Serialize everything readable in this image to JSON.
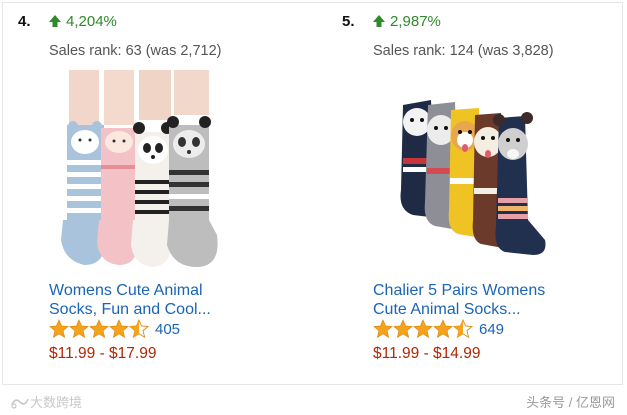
{
  "products": [
    {
      "rank": "4.",
      "change": "4,204%",
      "sales_rank": "Sales rank: 63 (was 2,712)",
      "title_line1": "Womens Cute Animal",
      "title_line2": "Socks, Fun and Cool...",
      "rating": 4.5,
      "review_count": "405",
      "price": "$11.99 - $17.99",
      "image_icon": "animal-socks-product-image"
    },
    {
      "rank": "5.",
      "change": "2,987%",
      "sales_rank": "Sales rank: 124 (was 3,828)",
      "title_line1": "Chalier 5 Pairs Womens",
      "title_line2": "Cute Animal Socks...",
      "rating": 4.5,
      "review_count": "649",
      "price": "$11.99 - $14.99",
      "image_icon": "dog-socks-product-image"
    }
  ],
  "watermark": {
    "left": "大数跨境",
    "right": "头条号 / 亿恩网"
  },
  "colors": {
    "up_arrow": "#2f8a2a",
    "link": "#1a64b8",
    "price": "#b12704",
    "star": "#f7a21b"
  }
}
